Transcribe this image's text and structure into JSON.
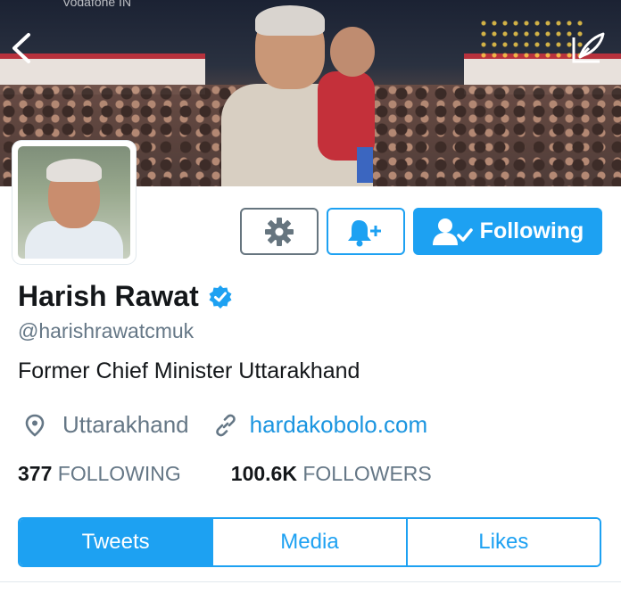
{
  "status_bar": {
    "carrier": "Vodafone IN"
  },
  "header": {
    "back_icon": "chevron-left-icon",
    "compose_icon": "feather-compose-icon"
  },
  "profile": {
    "name": "Harish Rawat",
    "verified": true,
    "handle": "@harishrawatcmuk",
    "bio": "Former Chief Minister Uttarakhand",
    "location": "Uttarakhand",
    "website": "hardakobolo.com"
  },
  "actions": {
    "settings_icon": "gear-icon",
    "notify_icon": "bell-plus-icon",
    "following_label": "Following"
  },
  "stats": {
    "following_count": "377",
    "following_label": "FOLLOWING",
    "followers_count": "100.6K",
    "followers_label": "FOLLOWERS"
  },
  "tabs": [
    {
      "label": "Tweets",
      "active": true
    },
    {
      "label": "Media",
      "active": false
    },
    {
      "label": "Likes",
      "active": false
    }
  ],
  "colors": {
    "accent": "#1da1f2",
    "text": "#14171a",
    "muted": "#657786",
    "link": "#1b95e0"
  }
}
